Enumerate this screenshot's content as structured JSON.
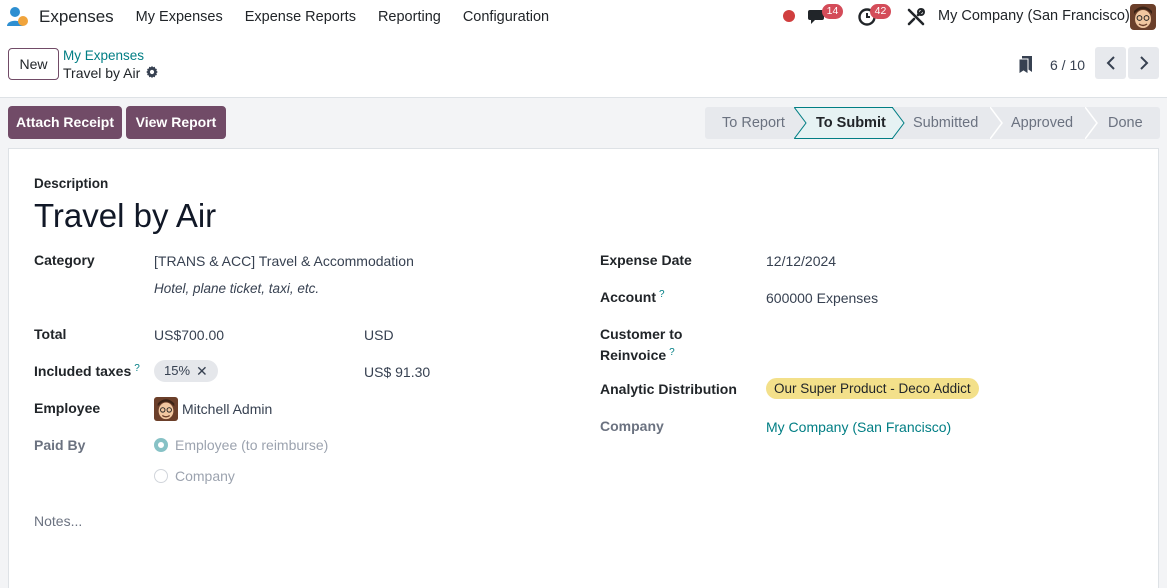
{
  "navbar": {
    "app_name": "Expenses",
    "menu": [
      "My Expenses",
      "Expense Reports",
      "Reporting",
      "Configuration"
    ],
    "messages_count": "14",
    "activities_count": "42",
    "company": "My Company (San Francisco)",
    "icons": [
      "app-logo-icon",
      "record-dot-icon",
      "chat-icon",
      "activity-clock-icon",
      "debug-tools-icon"
    ]
  },
  "control_panel": {
    "new_label": "New",
    "breadcrumb_parent": "My Expenses",
    "breadcrumb_current": "Travel by Air",
    "pager": "6 / 10"
  },
  "actions": {
    "attach_receipt": "Attach Receipt",
    "view_report": "View Report"
  },
  "statusbar": {
    "stages": [
      "To Report",
      "To Submit",
      "Submitted",
      "Approved",
      "Done"
    ],
    "active": "To Submit"
  },
  "form": {
    "description_label": "Description",
    "title": "Travel by Air",
    "category_label": "Category",
    "category_value": "[TRANS & ACC] Travel & Accommodation",
    "category_hint": "Hotel, plane ticket, taxi, etc.",
    "total_label": "Total",
    "total_value": "US$700.00",
    "currency": "USD",
    "taxes_label": "Included taxes",
    "tax_tag": "15%",
    "tax_amount": "US$ 91.30",
    "employee_label": "Employee",
    "employee_value": "Mitchell Admin",
    "paid_by_label": "Paid By",
    "paid_by_options": [
      "Employee (to reimburse)",
      "Company"
    ],
    "paid_by_selected": "Employee (to reimburse)",
    "notes_placeholder": "Notes...",
    "expense_date_label": "Expense Date",
    "expense_date_value": "12/12/2024",
    "account_label": "Account",
    "account_value": "600000 Expenses",
    "customer_label_line1": "Customer to",
    "customer_label_line2": "Reinvoice",
    "analytic_label": "Analytic Distribution",
    "analytic_value": "Our Super Product - Deco Addict",
    "company_label": "Company",
    "company_value": "My Company (San Francisco)",
    "help_mark": "?"
  },
  "colors": {
    "brand": "#714b67",
    "link": "#017e84",
    "badge": "#d44c59",
    "analytic_tag": "#f3e08a"
  }
}
